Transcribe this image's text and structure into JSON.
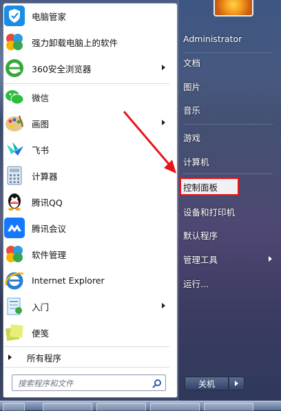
{
  "pinned_apps": [
    {
      "label": "电脑管家",
      "icon": "shield-icon",
      "color": "#1a8ee6",
      "submenu": false
    },
    {
      "label": "强力卸载电脑上的软件",
      "icon": "colorful-clover-icon",
      "color": "#e84a3b",
      "submenu": false
    },
    {
      "label": "360安全浏览器",
      "icon": "browser-e-icon",
      "color": "#35a838",
      "submenu": true
    },
    {
      "label": "微信",
      "icon": "wechat-icon",
      "color": "#2dbe3c",
      "submenu": false
    },
    {
      "label": "画图",
      "icon": "paint-palette-icon",
      "color": "#d9a14a",
      "submenu": true
    },
    {
      "label": "飞书",
      "icon": "feishu-bird-icon",
      "color": "#1f6fe8",
      "submenu": false
    },
    {
      "label": "计算器",
      "icon": "calculator-icon",
      "color": "#6f8db0",
      "submenu": false
    },
    {
      "label": "腾讯QQ",
      "icon": "qq-penguin-icon",
      "color": "#111111",
      "submenu": false
    },
    {
      "label": "腾讯会议",
      "icon": "tencent-meeting-icon",
      "color": "#1677ff",
      "submenu": false
    },
    {
      "label": "软件管理",
      "icon": "colorful-clover-icon",
      "color": "#2f9be0",
      "submenu": false
    },
    {
      "label": "Internet Explorer",
      "icon": "ie-icon",
      "color": "#2a7fd4",
      "submenu": false
    },
    {
      "label": "入门",
      "icon": "getting-started-icon",
      "color": "#5fa8d8",
      "submenu": true
    },
    {
      "label": "便笺",
      "icon": "sticky-notes-icon",
      "color": "#c9d84a",
      "submenu": false
    }
  ],
  "all_programs_label": "所有程序",
  "search_placeholder": "搜索程序和文件",
  "right_items": [
    {
      "label": "Administrator",
      "submenu": false
    },
    {
      "label": "文档",
      "submenu": false
    },
    {
      "label": "图片",
      "submenu": false
    },
    {
      "label": "音乐",
      "submenu": false
    },
    {
      "label": "游戏",
      "submenu": false
    },
    {
      "label": "计算机",
      "submenu": false
    },
    {
      "label": "控制面板",
      "submenu": false,
      "highlighted": true
    },
    {
      "label": "设备和打印机",
      "submenu": false
    },
    {
      "label": "默认程序",
      "submenu": false
    },
    {
      "label": "管理工具",
      "submenu": true
    },
    {
      "label": "运行...",
      "submenu": false
    }
  ],
  "shutdown_label": "关机",
  "colors": {
    "highlight_box": "#e8141c",
    "annotation_arrow": "#e8141c"
  }
}
